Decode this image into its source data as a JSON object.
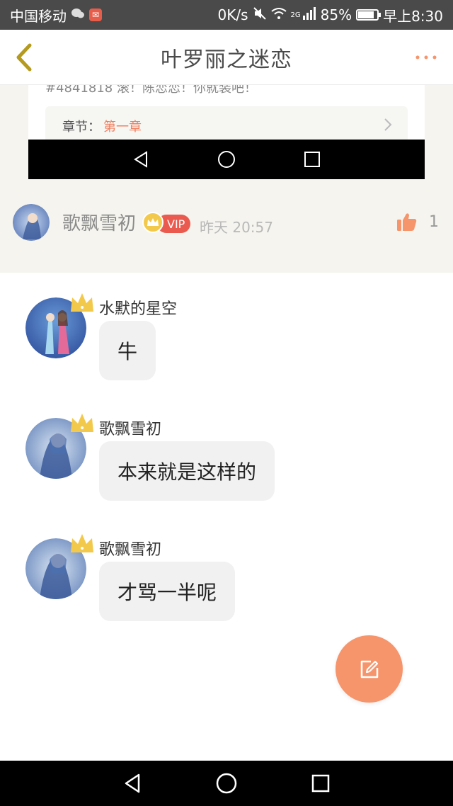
{
  "status_bar": {
    "carrier": "中国移动",
    "net_speed": "0K/s",
    "network": "2G",
    "battery_percent": "85%",
    "battery_level": 0.85,
    "time": "早上8:30"
  },
  "header": {
    "title": "叶罗丽之迷恋"
  },
  "embed": {
    "cut_text": "#4841818 滚！陈恋恋！你就装吧！",
    "chapter_label": "章节：",
    "chapter_value": "第一章"
  },
  "comment": {
    "author": "歌飘雪初",
    "vip_label": "VIP",
    "time": "昨天 20:57",
    "likes": "1"
  },
  "replies": [
    {
      "author": "水默的星空",
      "text": "牛"
    },
    {
      "author": "歌飘雪初",
      "text": "本来就是这样的"
    },
    {
      "author": "歌飘雪初",
      "text": "才骂一半呢"
    }
  ],
  "colors": {
    "accent": "#f6946b",
    "vip": "#ea5a4f",
    "crown": "#f3c94b",
    "status_bar": "#4a4a4a"
  }
}
